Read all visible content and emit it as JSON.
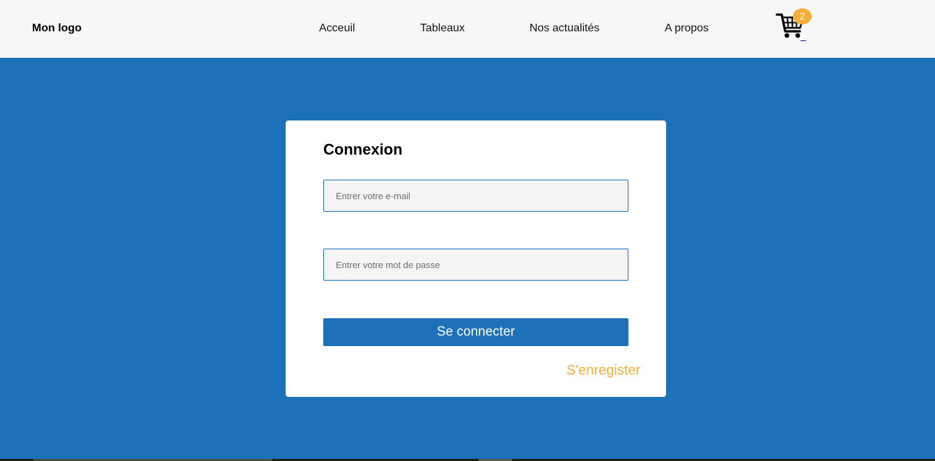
{
  "header": {
    "logo": "Mon logo",
    "nav": [
      {
        "label": "Acceuil"
      },
      {
        "label": "Tableaux"
      },
      {
        "label": "Nos actualités"
      },
      {
        "label": "A propos"
      }
    ],
    "cart": {
      "icon": "cart-icon",
      "count": "2"
    }
  },
  "login": {
    "title": "Connexion",
    "email_placeholder": "Entrer votre e-mail",
    "email_value": "",
    "password_placeholder": "Entrer votre mot de passe",
    "password_value": "",
    "submit_label": "Se connecter",
    "register_label": "S'enregister"
  },
  "colors": {
    "primary": "#1d71b8",
    "accent": "#f6ae3a",
    "nav_bg": "#f7f7f7",
    "card_bg": "#ffffff"
  }
}
